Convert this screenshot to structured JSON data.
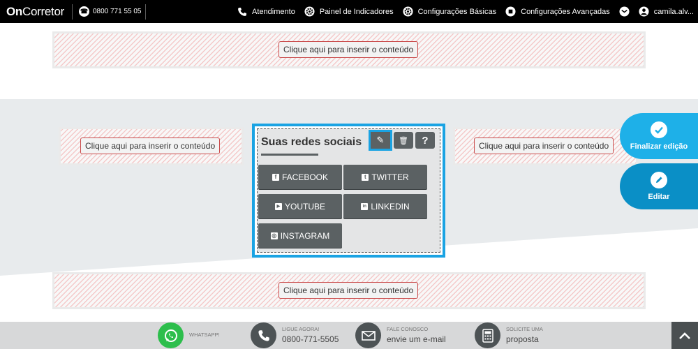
{
  "header": {
    "logo_bold": "On",
    "logo_rest": "Corretor",
    "phone": "0800 771 55 05",
    "nav": [
      {
        "icon": "phone-icon",
        "label": "Atendimento"
      },
      {
        "icon": "gear-icon",
        "label": "Painel de Indicadores"
      },
      {
        "icon": "gear-icon",
        "label": "Configurações Básicas"
      },
      {
        "icon": "square-icon",
        "label": "Configurações Avançadas"
      },
      {
        "icon": "mail-icon",
        "label": ""
      },
      {
        "icon": "user-icon",
        "label": "camila.alv..."
      }
    ]
  },
  "placeholders": {
    "top": "Clique aqui para inserir o conteúdo",
    "left": "Clique aqui para inserir o conteúdo",
    "right": "Clique aqui para inserir o conteúdo",
    "bottom": "Clique aqui para inserir o conteúdo"
  },
  "social": {
    "title": "Suas redes sociais",
    "tools": {
      "edit": "✎",
      "delete": "🗑",
      "help": "?"
    },
    "buttons": [
      {
        "icon": "f",
        "label": "FACEBOOK"
      },
      {
        "icon": "t",
        "label": "TWITTER"
      },
      {
        "icon": "▶",
        "label": "YOUTUBE"
      },
      {
        "icon": "in",
        "label": "LINKEDIN"
      },
      {
        "icon": "◎",
        "label": "INSTAGRAM"
      }
    ]
  },
  "floating": {
    "finish_label": "Finalizar edição",
    "edit_label": "Editar"
  },
  "footer": {
    "whatsapp_small": "WHATSAPP!",
    "call_small": "LIGUE AGORA!",
    "call_big": "0800-771-5505",
    "mail_small": "FALE CONOSCO",
    "mail_big": "envie um e-mail",
    "quote_small": "SOLICITE UMA",
    "quote_big": "proposta"
  },
  "colors": {
    "accent": "#1aa3e3",
    "button_dark": "#5b6163",
    "whatsapp": "#2dbe4c"
  }
}
